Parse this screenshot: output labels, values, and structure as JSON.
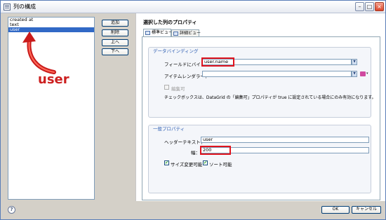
{
  "window": {
    "title": "列の構成",
    "buttons": {
      "minimize": "–",
      "maximize": "□",
      "close": "×"
    }
  },
  "column_list": {
    "items": [
      "created at",
      "text",
      "user"
    ],
    "selected_index": 2
  },
  "annotation": {
    "label": "user",
    "color": "#cc2020"
  },
  "side_buttons": {
    "add": "追加",
    "delete": "削除",
    "up": "上へ",
    "down": "下へ"
  },
  "properties": {
    "header": "選択した列のプロパティ",
    "tabs": [
      "標準ビュー",
      "詳細ビュー"
    ],
    "active_tab": 0
  },
  "data_binding": {
    "title": "データバインディング",
    "field_label": "フィールドにバインド：",
    "field_value": "user.name",
    "renderer_label": "アイテムレンダラー：",
    "renderer_value": "",
    "editable_label": "編集可",
    "editable_checked": false,
    "note": "チェックボックスは、DataGrid の「編集可」プロパティが true に設定されている場合にのみ有効になります。"
  },
  "general": {
    "title": "一般プロパティ",
    "header_label": "ヘッダーテキスト：",
    "header_value": "user",
    "width_label": "幅：",
    "width_value": "200",
    "resizable_label": "サイズ変更可能",
    "resizable_checked": true,
    "sortable_label": "ソート可能",
    "sortable_checked": true
  },
  "footer": {
    "help": "?",
    "ok": "OK",
    "cancel": "キャンセル"
  },
  "colors": {
    "highlight": "#e0141e",
    "selection": "#3169c6",
    "group_title": "#2f5fb3"
  }
}
